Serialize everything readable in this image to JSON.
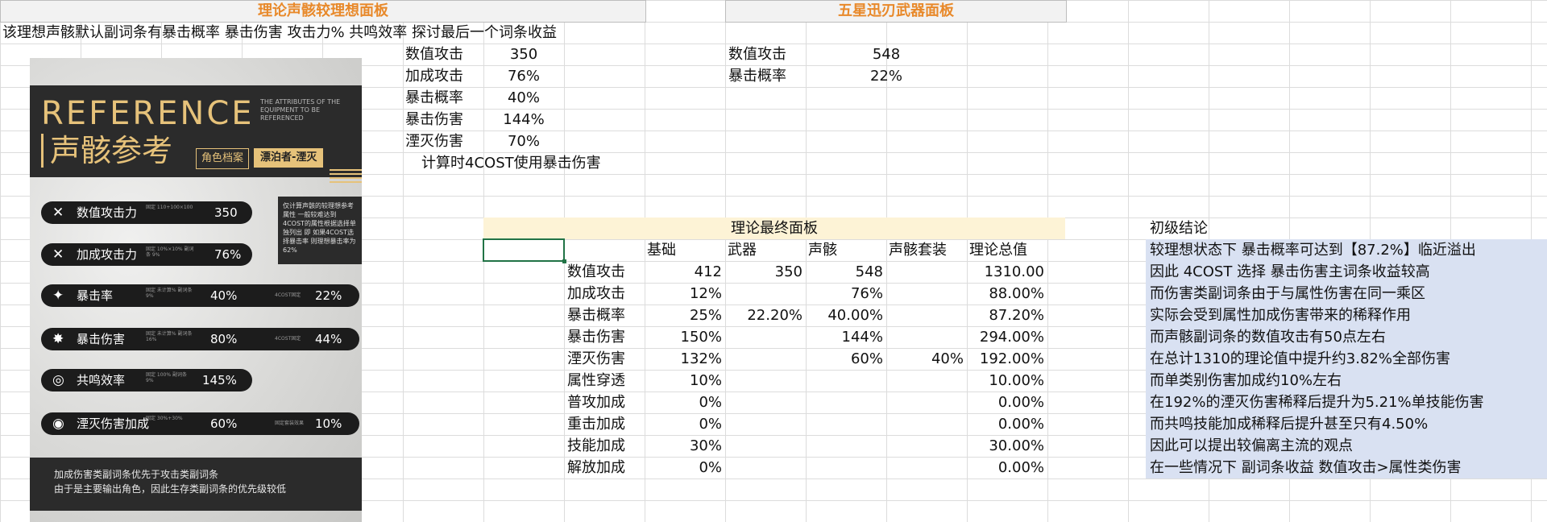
{
  "headers": {
    "left": "理论声骸较理想面板",
    "middle": "五星迅刃武器面板",
    "final": "理论最终面板",
    "conclusion": "初级结论"
  },
  "intro_line": "该理想声骸默认副词条有暴击概率 暴击伤害 攻击力% 共鸣效率 探讨最后一个词条收益",
  "ideal_panel": [
    {
      "label": "数值攻击",
      "value": "350"
    },
    {
      "label": "加成攻击",
      "value": "76%"
    },
    {
      "label": "暴击概率",
      "value": "40%"
    },
    {
      "label": "暴击伤害",
      "value": "144%"
    },
    {
      "label": "湮灭伤害",
      "value": "70%"
    }
  ],
  "ideal_note": "计算时4COST使用暴击伤害",
  "weapon_panel": [
    {
      "label": "数值攻击",
      "value": "548"
    },
    {
      "label": "暴击概率",
      "value": "22%"
    }
  ],
  "final_table": {
    "columns": [
      "基础",
      "武器",
      "声骸",
      "声骸套装",
      "理论总值"
    ],
    "rows": [
      {
        "label": "数值攻击",
        "base": "412",
        "weapon": "350",
        "echo": "548",
        "set": "",
        "total": "1310.00"
      },
      {
        "label": "加成攻击",
        "base": "12%",
        "weapon": "",
        "echo": "76%",
        "set": "",
        "total": "88.00%"
      },
      {
        "label": "暴击概率",
        "base": "25%",
        "weapon": "22.20%",
        "echo": "40.00%",
        "set": "",
        "total": "87.20%"
      },
      {
        "label": "暴击伤害",
        "base": "150%",
        "weapon": "",
        "echo": "144%",
        "set": "",
        "total": "294.00%"
      },
      {
        "label": "湮灭伤害",
        "base": "132%",
        "weapon": "",
        "echo": "60%",
        "set": "40%",
        "total": "192.00%"
      },
      {
        "label": "属性穿透",
        "base": "10%",
        "weapon": "",
        "echo": "",
        "set": "",
        "total": "10.00%"
      },
      {
        "label": "普攻加成",
        "base": "0%",
        "weapon": "",
        "echo": "",
        "set": "",
        "total": "0.00%"
      },
      {
        "label": "重击加成",
        "base": "0%",
        "weapon": "",
        "echo": "",
        "set": "",
        "total": "0.00%"
      },
      {
        "label": "技能加成",
        "base": "30%",
        "weapon": "",
        "echo": "",
        "set": "",
        "total": "30.00%"
      },
      {
        "label": "解放加成",
        "base": "0%",
        "weapon": "",
        "echo": "",
        "set": "",
        "total": "0.00%"
      }
    ]
  },
  "conclusions": [
    "较理想状态下 暴击概率可达到【87.2%】临近溢出",
    "因此 4COST 选择 暴击伤害主词条收益较高",
    "而伤害类副词条由于与属性伤害在同一乘区",
    "实际会受到属性加成伤害带来的稀释作用",
    "而声骸副词条的数值攻击有50点左右",
    "在总计1310的理论值中提升约3.82%全部伤害",
    "而单类别伤害加成约10%左右",
    "在192%的湮灭伤害稀释后提升为5.21%单技能伤害",
    "而共鸣技能加成稀释后提升甚至只有4.50%",
    "因此可以提出较偏离主流的观点",
    "在一些情况下 副词条收益 数值攻击>属性类伤害"
  ],
  "poster": {
    "title_en": "REFERENCE",
    "title_cn": "声骸参考",
    "desc_en": "THE ATTRIBUTES OF THE EQUIPMENT TO BE REFERENCED",
    "tag_archive": "角色档案",
    "tag_char": "漂泊者-湮灭",
    "note": "仅计算声骸的较理想参考属性 一般较难达到\n4COST的属性根据选择单独列出 即 如果4COST选择暴击率 则理想暴击率为62%",
    "stats": [
      {
        "icon": "sword-icon",
        "glyph": "✕",
        "label": "数值攻击力",
        "tiny": "固定 110+100×100",
        "v1": "350",
        "tiny2": "",
        "v2": ""
      },
      {
        "icon": "sword-icon",
        "glyph": "✕",
        "label": "加成攻击力",
        "tiny": "固定 10%×10% 副词条 9%",
        "v1": "76%",
        "tiny2": "",
        "v2": ""
      },
      {
        "icon": "crit-icon",
        "glyph": "✦",
        "label": "暴击率",
        "tiny": "固定 未计算% 副词条 9%",
        "v1": "40%",
        "tiny2": "4COST固定",
        "v2": "22%"
      },
      {
        "icon": "crit-damage-icon",
        "glyph": "✸",
        "label": "暴击伤害",
        "tiny": "固定 未计算% 副词条 16%",
        "v1": "80%",
        "tiny2": "4COST固定",
        "v2": "44%"
      },
      {
        "icon": "resonance-icon",
        "glyph": "◎",
        "label": "共鸣效率",
        "tiny": "固定 100% 副词条 9%",
        "v1": "145%",
        "tiny2": "",
        "v2": ""
      },
      {
        "icon": "havoc-icon",
        "glyph": "◉",
        "label": "湮灭伤害加成",
        "tiny": "固定 30%+30%",
        "v1": "60%",
        "tiny2": "固定套装效果",
        "v2": "10%"
      }
    ],
    "bottom_text": "加成伤害类副词条优先于攻击类副词条\n由于是主要输出角色，因此生存类副词条的优先级较低"
  },
  "colors": {
    "header_text": "#e8892a",
    "yellow_band": "#fdf3d6",
    "blue_band": "#d9e1f2",
    "poster_dark": "#2b2b2b",
    "poster_gold": "#e6c27a",
    "selection": "#217346"
  }
}
